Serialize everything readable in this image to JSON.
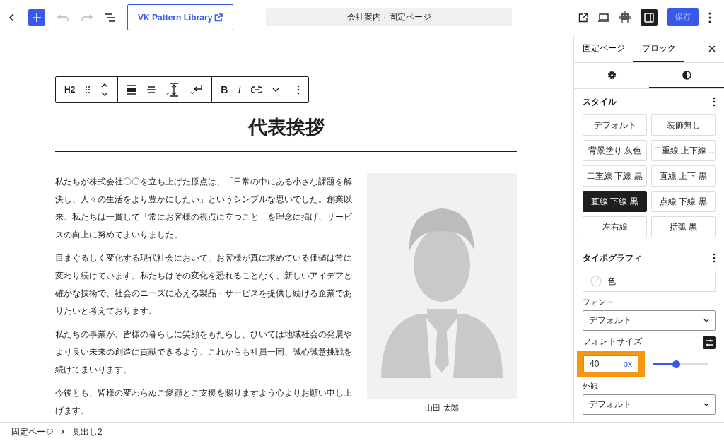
{
  "topbar": {
    "pattern_button": "VK Pattern Library",
    "document_title": "会社案内 · 固定ページ",
    "settings_toggle": {
      "on": true
    },
    "save_button": {
      "label": "保存",
      "disabled": true
    }
  },
  "block_toolbar": {
    "block_type": "H2",
    "format_buttons": [
      "B",
      "I"
    ]
  },
  "content": {
    "heading": "代表挨拶",
    "paragraphs": [
      "私たちが株式会社〇〇を立ち上げた原点は、「日常の中にある小さな課題を解決し、人々の生活をより豊かにしたい」というシンプルな思いでした。創業以来、私たちは一貫して「常にお客様の視点に立つこと」を理念に掲げ、サービスの向上に努めてまいりました。",
      "目まぐるしく変化する現代社会において、お客様が真に求めている価値は常に変わり続けています。私たちはその変化を恐れることなく、新しいアイデアと確かな技術で、社会のニーズに応える製品・サービスを提供し続ける企業でありたいと考えております。",
      "私たちの事業が、皆様の暮らしに笑顔をもたらし、ひいては地域社会の発展やより良い未来の創造に貢献できるよう、これからも社員一同、誠心誠意挑戦を続けてまいります。",
      "今後とも、皆様の変わらぬご愛顧とご支援を賜りますよう心よりお願い申し上げます。"
    ],
    "image": {
      "kind": "picture",
      "caption": "山田 太郎"
    }
  },
  "sidebar": {
    "tabs": [
      {
        "label": "固定ページ",
        "selected": false
      },
      {
        "label": "ブロック",
        "selected": true
      }
    ],
    "icon_tabs": [
      {
        "kind": "settings",
        "selected": false
      },
      {
        "kind": "styles",
        "selected": true
      }
    ],
    "style_section": {
      "title": "スタイル",
      "styles": [
        {
          "label": "デフォルト",
          "selected": false
        },
        {
          "label": "装飾無し",
          "selected": false
        },
        {
          "label": "背景塗り 灰色",
          "selected": false
        },
        {
          "label": "二重線 上下線...",
          "selected": false
        },
        {
          "label": "二重線 下線 黒",
          "selected": false
        },
        {
          "label": "直線 上下 黒",
          "selected": false
        },
        {
          "label": "直線 下線 黒",
          "selected": true
        },
        {
          "label": "点線 下線 黒",
          "selected": false
        },
        {
          "label": "左右線",
          "selected": false
        },
        {
          "label": "括弧 黒",
          "selected": false
        }
      ]
    },
    "typography": {
      "title": "タイポグラフィ",
      "color_label": "色",
      "font_label": "フォント",
      "font_value": "デフォルト",
      "size_label": "フォントサイズ",
      "size_value": "40",
      "size_unit": "px",
      "highlighted": true,
      "size_slider": {
        "level": 0.41
      },
      "appearance_label": "外観",
      "appearance_value": "デフォルト"
    }
  },
  "breadcrumb": [
    "固定ページ",
    "見出し2"
  ]
}
